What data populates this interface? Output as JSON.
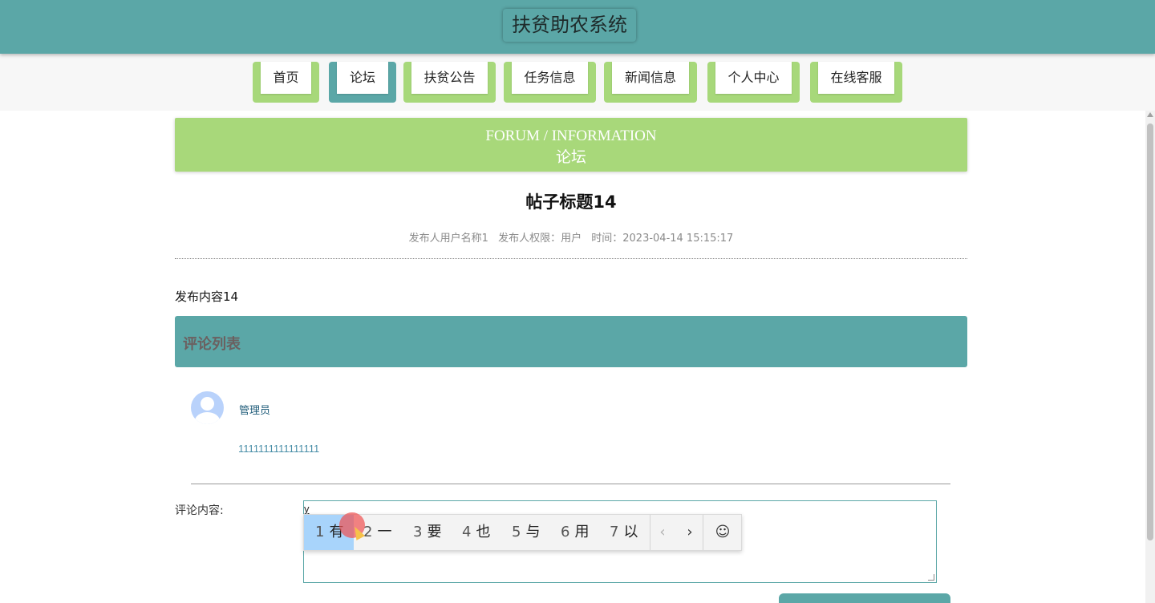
{
  "header": {
    "title": "扶贫助农系统"
  },
  "nav": {
    "items": [
      {
        "label": "首页"
      },
      {
        "label": "论坛"
      },
      {
        "label": "扶贫公告"
      },
      {
        "label": "任务信息"
      },
      {
        "label": "新闻信息"
      },
      {
        "label": "个人中心"
      },
      {
        "label": "在线客服"
      }
    ],
    "active_index": 1
  },
  "banner": {
    "en": "FORUM / INFORMATION",
    "cn": "论坛"
  },
  "post": {
    "title": "帖子标题14",
    "author": "发布人用户名称1",
    "role": "发布人权限：用户",
    "time": "时间：2023-04-14 15:15:17",
    "content": "发布内容14"
  },
  "comments": {
    "header": "评论列表",
    "items": [
      {
        "user": "管理员",
        "text": "1111111111111111"
      }
    ]
  },
  "comment_form": {
    "label": "评论内容:",
    "typed_value": "y"
  },
  "ime": {
    "candidates": [
      {
        "num": "1",
        "text": "有"
      },
      {
        "num": "2",
        "text": "一"
      },
      {
        "num": "3",
        "text": "要"
      },
      {
        "num": "4",
        "text": "也"
      },
      {
        "num": "5",
        "text": "与"
      },
      {
        "num": "6",
        "text": "用"
      },
      {
        "num": "7",
        "text": "以"
      }
    ],
    "prev": "‹",
    "next": "›",
    "emoji": "☺"
  },
  "colors": {
    "teal": "#5ba7a7",
    "green": "#a8d87a"
  }
}
